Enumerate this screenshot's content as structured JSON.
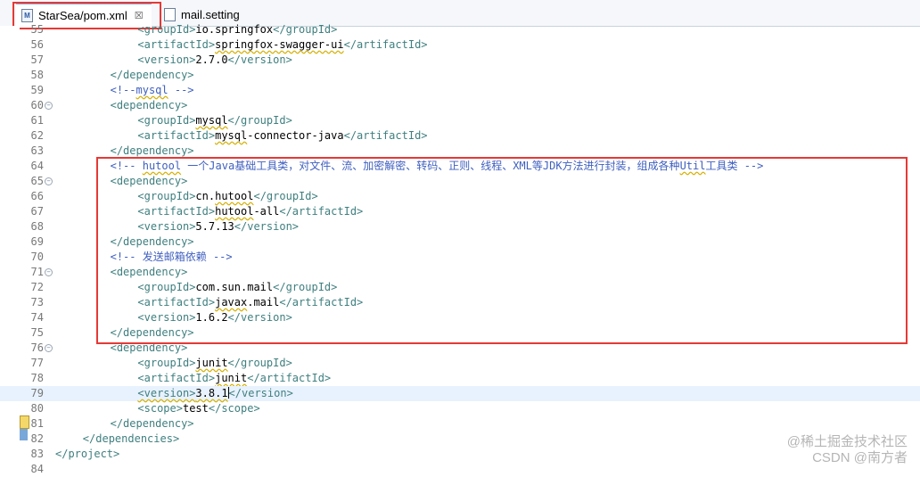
{
  "tabs": [
    {
      "label": "StarSea/pom.xml",
      "icon": "M",
      "close": "☒"
    },
    {
      "label": "mail.setting"
    }
  ],
  "lines": [
    {
      "num": "55",
      "fold": false,
      "html": "<span class=\"t\">&lt;groupId&gt;</span><span class=\"tx\">io.springfox</span><span class=\"t\">&lt;/groupId&gt;</span>",
      "indent": 3
    },
    {
      "num": "56",
      "fold": false,
      "html": "<span class=\"t\">&lt;artifactId&gt;</span><span class=\"tx sq\">springfox-swagger-ui</span><span class=\"t\">&lt;/artifactId&gt;</span>",
      "indent": 3
    },
    {
      "num": "57",
      "fold": false,
      "html": "<span class=\"t\">&lt;version&gt;</span><span class=\"tx\">2.7.0</span><span class=\"t\">&lt;/version&gt;</span>",
      "indent": 3
    },
    {
      "num": "58",
      "fold": false,
      "html": "<span class=\"t\">&lt;/dependency&gt;</span>",
      "indent": 2
    },
    {
      "num": "59",
      "fold": false,
      "html": "<span class=\"cm\">&lt;!--<span class=\"sq\">mysql</span> --&gt;</span>",
      "indent": 2
    },
    {
      "num": "60",
      "fold": true,
      "html": "<span class=\"t\">&lt;dependency&gt;</span>",
      "indent": 2
    },
    {
      "num": "61",
      "fold": false,
      "html": "<span class=\"t\">&lt;groupId&gt;</span><span class=\"tx sq\">mysql</span><span class=\"t\">&lt;/groupId&gt;</span>",
      "indent": 3
    },
    {
      "num": "62",
      "fold": false,
      "html": "<span class=\"t\">&lt;artifactId&gt;</span><span class=\"tx sq\">mysql</span><span class=\"tx\">-connector-java</span><span class=\"t\">&lt;/artifactId&gt;</span>",
      "indent": 3
    },
    {
      "num": "63",
      "fold": false,
      "html": "<span class=\"t\">&lt;/dependency&gt;</span>",
      "indent": 2
    },
    {
      "num": "64",
      "fold": false,
      "html": "<span class=\"cm\">&lt;!-- <span class=\"sq\">hutool</span> 一个Java基础工具类，对文件、流、加密解密、转码、正则、线程、XML等JDK方法进行封装，组成各种<span class=\"sq\">Util</span>工具类 --&gt;</span>",
      "indent": 2
    },
    {
      "num": "65",
      "fold": true,
      "html": "<span class=\"t\">&lt;dependency&gt;</span>",
      "indent": 2
    },
    {
      "num": "66",
      "fold": false,
      "html": "<span class=\"t\">&lt;groupId&gt;</span><span class=\"tx\">cn.<span class=\"sq\">hutool</span></span><span class=\"t\">&lt;/groupId&gt;</span>",
      "indent": 3
    },
    {
      "num": "67",
      "fold": false,
      "html": "<span class=\"t\">&lt;artifactId&gt;</span><span class=\"tx sq\">hutool</span><span class=\"tx\">-all</span><span class=\"t\">&lt;/artifactId&gt;</span>",
      "indent": 3
    },
    {
      "num": "68",
      "fold": false,
      "html": "<span class=\"t\">&lt;version&gt;</span><span class=\"tx\">5.7.13</span><span class=\"t\">&lt;/version&gt;</span>",
      "indent": 3
    },
    {
      "num": "69",
      "fold": false,
      "html": "<span class=\"t\">&lt;/dependency&gt;</span>",
      "indent": 2
    },
    {
      "num": "70",
      "fold": false,
      "html": "<span class=\"cm\">&lt;!-- 发送邮箱依赖 --&gt;</span>",
      "indent": 2
    },
    {
      "num": "71",
      "fold": true,
      "html": "<span class=\"t\">&lt;dependency&gt;</span>",
      "indent": 2
    },
    {
      "num": "72",
      "fold": false,
      "html": "<span class=\"t\">&lt;groupId&gt;</span><span class=\"tx\">com.sun.mail</span><span class=\"t\">&lt;/groupId&gt;</span>",
      "indent": 3
    },
    {
      "num": "73",
      "fold": false,
      "html": "<span class=\"t\">&lt;artifactId&gt;</span><span class=\"tx sq\">javax</span><span class=\"tx\">.mail</span><span class=\"t\">&lt;/artifactId&gt;</span>",
      "indent": 3
    },
    {
      "num": "74",
      "fold": false,
      "html": "<span class=\"t\">&lt;version&gt;</span><span class=\"tx\">1.6.2</span><span class=\"t\">&lt;/version&gt;</span>",
      "indent": 3
    },
    {
      "num": "75",
      "fold": false,
      "html": "<span class=\"t\">&lt;/dependency&gt;</span>",
      "indent": 2
    },
    {
      "num": "76",
      "fold": true,
      "html": "<span class=\"t\">&lt;dependency&gt;</span>",
      "indent": 2
    },
    {
      "num": "77",
      "fold": false,
      "html": "<span class=\"t\">&lt;groupId&gt;</span><span class=\"tx sq\">junit</span><span class=\"t\">&lt;/groupId&gt;</span>",
      "indent": 3
    },
    {
      "num": "78",
      "fold": false,
      "html": "<span class=\"t\">&lt;artifactId&gt;</span><span class=\"tx sq\">junit</span><span class=\"t\">&lt;/artifactId&gt;</span>",
      "indent": 3
    },
    {
      "num": "79",
      "fold": false,
      "current": true,
      "html": "<span class=\"t sq\">&lt;version&gt;</span><span class=\"tx sq\">3.8.1</span><span class=\"caret\"></span><span class=\"t\">&lt;/version&gt;</span>",
      "indent": 3
    },
    {
      "num": "80",
      "fold": false,
      "html": "<span class=\"t\">&lt;scope&gt;</span><span class=\"tx\">test</span><span class=\"t\">&lt;/scope&gt;</span>",
      "indent": 3
    },
    {
      "num": "81",
      "fold": false,
      "html": "<span class=\"t\">&lt;/dependency&gt;</span>",
      "indent": 2
    },
    {
      "num": "82",
      "fold": false,
      "html": "<span class=\"t\">&lt;/dependencies&gt;</span>",
      "indent": 1
    },
    {
      "num": "83",
      "fold": false,
      "html": "<span class=\"t\">&lt;/project&gt;</span>",
      "indent": 0
    },
    {
      "num": "84",
      "fold": false,
      "html": "",
      "indent": 0
    }
  ],
  "watermark": {
    "line1": "@稀土掘金技术社区",
    "line2": "CSDN @南方者"
  },
  "colors": {
    "highlight_border": "#e53935",
    "tag": "#3f7f7f",
    "comment": "#3f5fbf",
    "current_line": "#e8f2fe"
  }
}
